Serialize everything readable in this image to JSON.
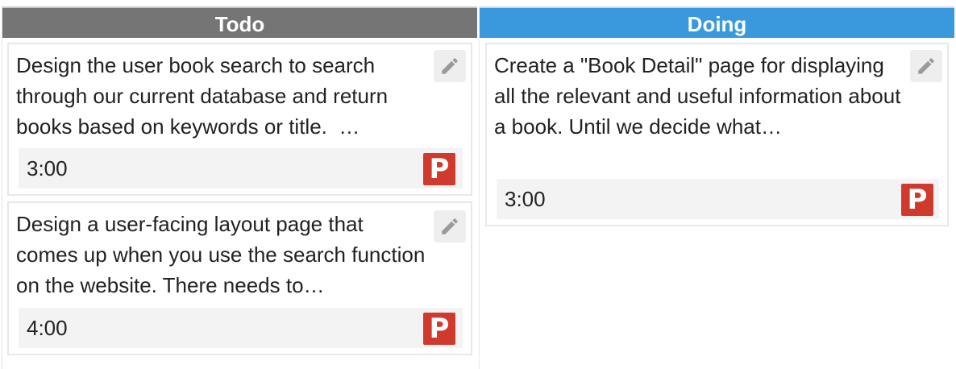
{
  "columns": [
    {
      "title": "Todo",
      "cards": [
        {
          "description": "Design the user book search to search through our current database and return books based on keywords or title.  …",
          "estimate": "3:00",
          "badge": "P"
        },
        {
          "description": "Design a user-facing layout page that comes up when you use the search function on the website. There needs to…",
          "estimate": "4:00",
          "badge": "P"
        }
      ]
    },
    {
      "title": "Doing",
      "cards": [
        {
          "description": "Create a \"Book Detail\" page for displaying all the relevant and useful information about a book. Until we decide what…",
          "estimate": "3:00",
          "badge": "P"
        }
      ]
    }
  ],
  "icons": {
    "edit": "pencil-icon"
  },
  "colors": {
    "todo_header": "#757575",
    "doing_header": "#3a98dc",
    "badge": "#cf3a2d"
  }
}
